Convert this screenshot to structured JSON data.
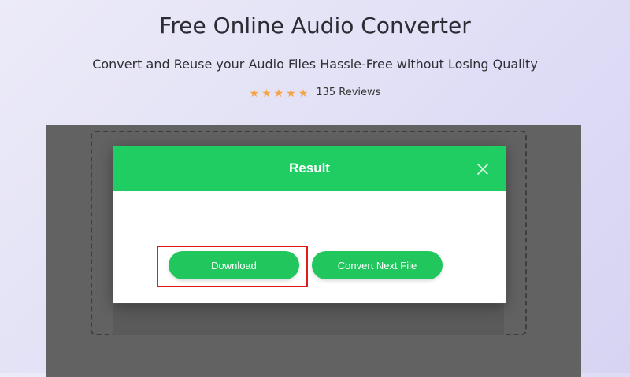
{
  "header": {
    "title": "Free Online Audio Converter",
    "subtitle": "Convert and Reuse your Audio Files Hassle-Free without Losing Quality",
    "rating": {
      "stars": 5,
      "star_char": "★",
      "reviews": "135 Reviews",
      "star_color": "#f5a34a"
    }
  },
  "modal": {
    "title": "Result",
    "close_icon": "close-icon",
    "download_label": "Download",
    "convert_next_label": "Convert Next File",
    "accent_color": "#20cd62"
  },
  "annotation": {
    "highlight_color": "#e01b1b"
  }
}
